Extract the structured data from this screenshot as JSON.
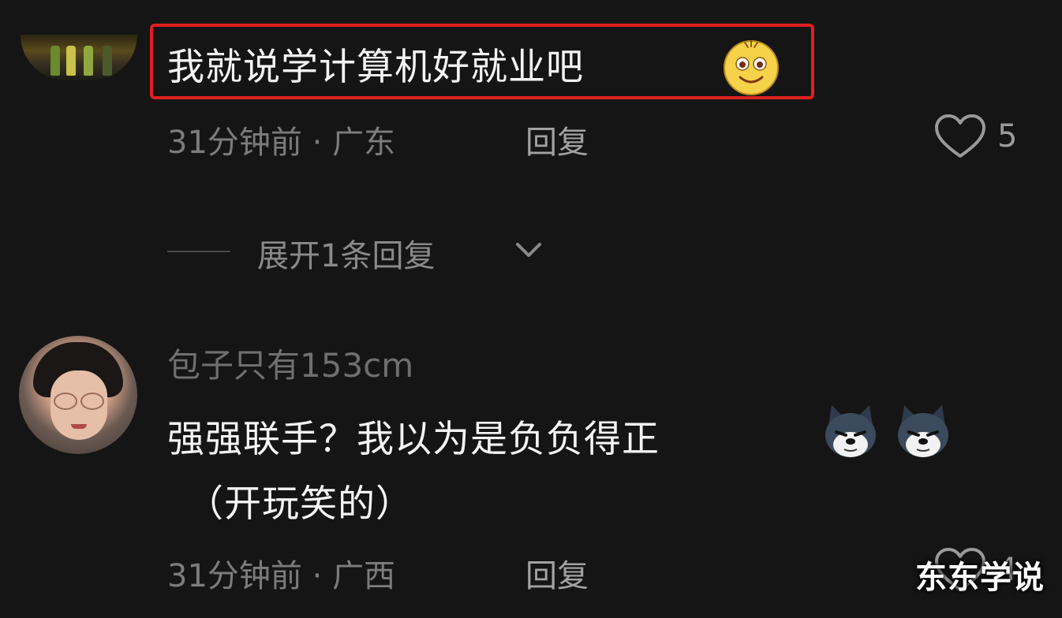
{
  "comments": [
    {
      "text": "我就说学计算机好就业吧",
      "emoji": "smile-emoji",
      "time": "31分钟前",
      "separator": "·",
      "location": "广东",
      "reply_label": "回复",
      "likes": "5",
      "highlighted": true,
      "highlight_color": "#e0201f"
    },
    {
      "username": "包子只有153cm",
      "text_line1": "强强联手？我以为是负负得正",
      "text_line2": "（开玩笑的）",
      "emojis": [
        "dog-emoji",
        "dog-emoji"
      ],
      "time": "31分钟前",
      "separator": "·",
      "location": "广西",
      "reply_label": "回复",
      "likes": "4"
    }
  ],
  "expand_replies": {
    "label": "展开1条回复",
    "icon": "chevron-down-icon"
  },
  "watermark": "东东学说",
  "colors": {
    "background": "#151515",
    "text": "#f4f4f4",
    "meta": "#7c7c7c"
  }
}
